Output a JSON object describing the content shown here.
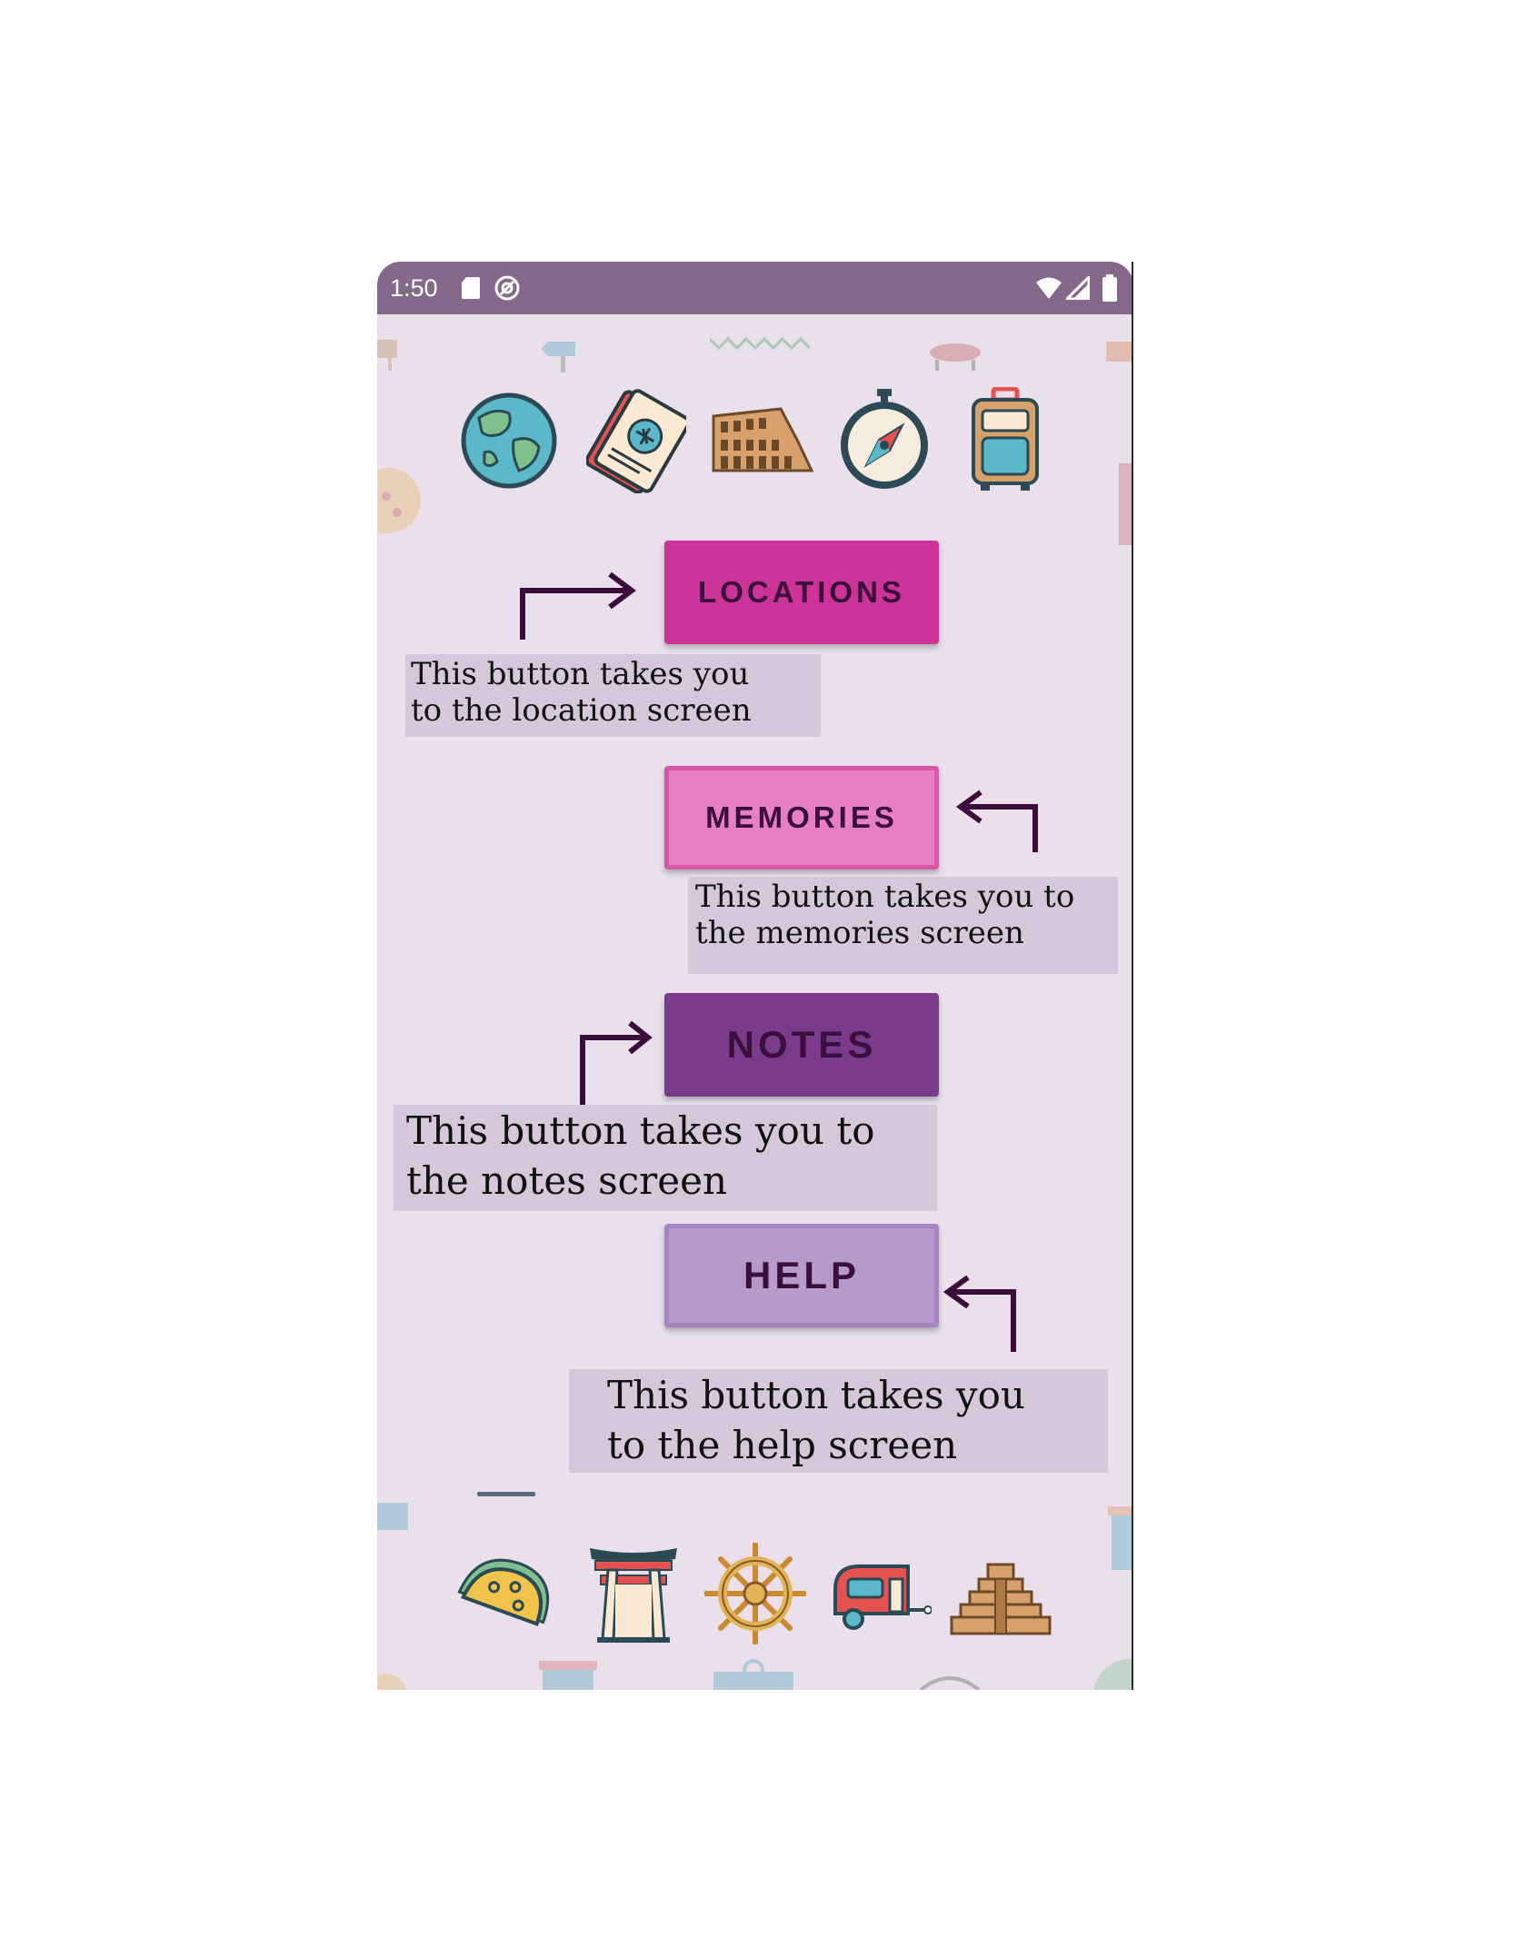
{
  "status_bar": {
    "time": "1:50",
    "icons": [
      "sd-card-icon",
      "at-sign-icon",
      "wifi-icon",
      "signal-icon",
      "battery-icon"
    ]
  },
  "top_icons": [
    "globe-icon",
    "plane-ticket-icon",
    "colosseum-icon",
    "compass-icon",
    "suitcase-icon"
  ],
  "bottom_icons": [
    "taco-icon",
    "torii-gate-icon",
    "ship-wheel-icon",
    "camper-trailer-icon",
    "pyramid-icon"
  ],
  "buttons": {
    "locations": "LOCATIONS",
    "memories": "MEMORIES",
    "notes": "NOTES",
    "help": "HELP"
  },
  "notes": {
    "locations": "This button takes you\nto the location screen",
    "memories": "This button takes you to\nthe memories screen",
    "notes": "This button takes you to\nthe notes screen",
    "help": "This button takes you\nto the help screen"
  },
  "colors": {
    "status_bar": "#85698b",
    "background": "#e9e0ec",
    "locations_button": "#cd3298",
    "memories_button": "#e97fc3",
    "notes_button": "#7a3b8a",
    "help_button": "#b59acb",
    "arrow": "#3a0d3a"
  }
}
